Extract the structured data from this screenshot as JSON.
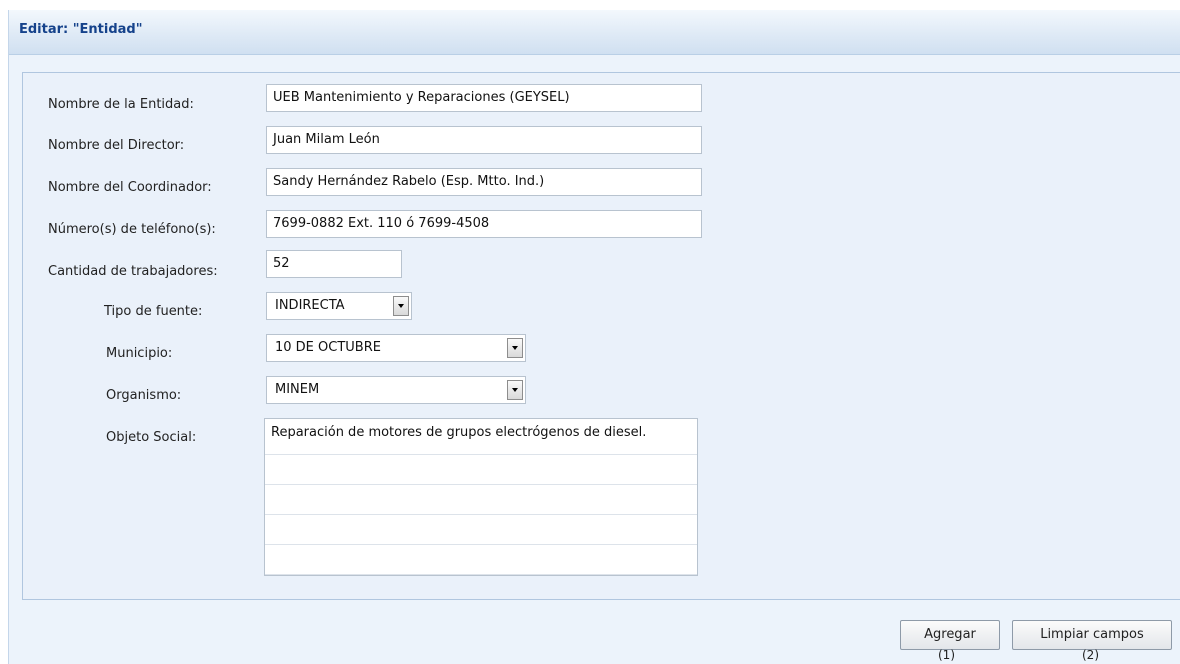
{
  "panel": {
    "title": "Editar: \"Entidad\""
  },
  "form": {
    "nombre_entidad": {
      "label": "Nombre de la Entidad:",
      "value": "UEB Mantenimiento y Reparaciones (GEYSEL)"
    },
    "nombre_director": {
      "label": "Nombre del Director:",
      "value": "Juan Milam León"
    },
    "nombre_coordinador": {
      "label": "Nombre del Coordinador:",
      "value": "Sandy Hernández Rabelo (Esp. Mtto. Ind.)"
    },
    "telefonos": {
      "label": "Número(s) de teléfono(s):",
      "value": "7699-0882 Ext. 110 ó 7699-4508"
    },
    "cantidad_trabajadores": {
      "label": "Cantidad de trabajadores:",
      "value": "52"
    },
    "tipo_fuente": {
      "label": "Tipo de fuente:",
      "selected": "INDIRECTA"
    },
    "municipio": {
      "label": "Municipio:",
      "selected": "10 DE OCTUBRE"
    },
    "organismo": {
      "label": "Organismo:",
      "selected": "MINEM"
    },
    "objeto_social": {
      "label": "Objeto Social:",
      "value": "Reparación de motores de grupos electrógenos de diesel."
    }
  },
  "buttons": {
    "agregar": {
      "label": "Agregar",
      "shortcut": "(1)"
    },
    "limpiar": {
      "label": "Limpiar campos",
      "shortcut": "(2)"
    }
  },
  "icons": {
    "dropdown": "chevron-down-icon"
  }
}
